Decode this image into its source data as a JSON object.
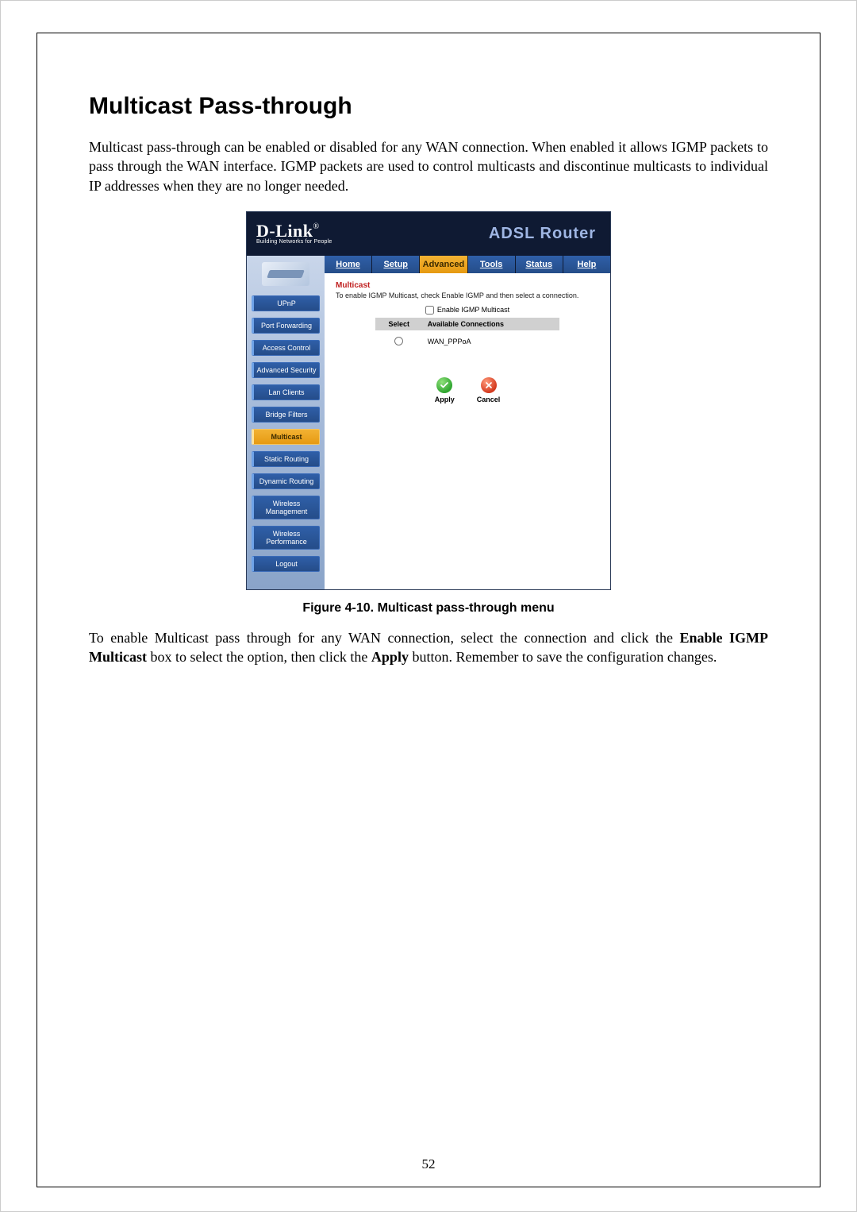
{
  "doc": {
    "title": "Multicast Pass-through",
    "intro": "Multicast pass-through can be enabled or disabled for any WAN connection. When enabled it allows IGMP packets to pass through the WAN interface. IGMP packets are used to control multicasts and discontinue multicasts to individual IP addresses when they are no longer needed.",
    "figure_caption": "Figure 4-10. Multicast pass-through menu",
    "instr_pre": "To enable Multicast pass through for any WAN connection, select the connection and click the ",
    "instr_bold1": "Enable IGMP Multicast",
    "instr_mid": " box to select the option, then click the ",
    "instr_bold2": "Apply",
    "instr_post": " button. Remember to save the configuration changes.",
    "page_number": "52"
  },
  "router": {
    "brand": "D-Link",
    "brand_tag": "Building Networks for People",
    "product": "ADSL Router",
    "tabs": [
      "Home",
      "Setup",
      "Advanced",
      "Tools",
      "Status",
      "Help"
    ],
    "active_tab": 2,
    "sidebar": {
      "items": [
        "UPnP",
        "Port Forwarding",
        "Access Control",
        "Advanced Security",
        "Lan Clients",
        "Bridge Filters",
        "Multicast",
        "Static Routing",
        "Dynamic Routing",
        "Wireless Management",
        "Wireless Performance",
        "Logout"
      ],
      "active_index": 6
    },
    "panel": {
      "title": "Multicast",
      "hint": "To enable IGMP Multicast, check Enable IGMP and then select a connection.",
      "enable_label": "Enable IGMP Multicast",
      "col_select": "Select",
      "col_conn": "Available Connections",
      "rows": [
        {
          "name": "WAN_PPPoA"
        }
      ],
      "apply": "Apply",
      "cancel": "Cancel"
    }
  }
}
